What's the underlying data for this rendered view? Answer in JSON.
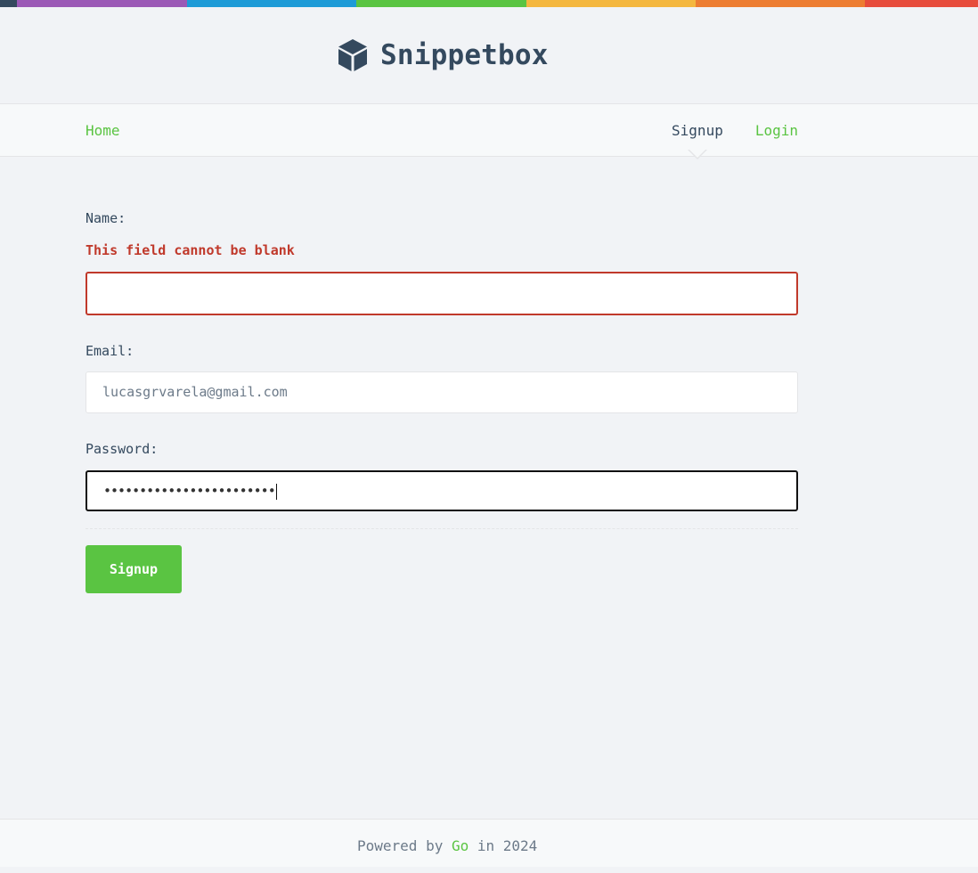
{
  "colors": {
    "bar": [
      "#34495e",
      "#9b59b6",
      "#3498db",
      "#5ac442",
      "#f4b73f",
      "#ed7d32",
      "#e74c3c"
    ],
    "accent": "#5ac442",
    "error": "#c0392b",
    "text": "#34495e"
  },
  "header": {
    "logo_icon": "box-icon",
    "brand": "Snippetbox"
  },
  "nav": {
    "home": "Home",
    "signup": "Signup",
    "login": "Login"
  },
  "form": {
    "name": {
      "label": "Name:",
      "error": "This field cannot be blank",
      "value": ""
    },
    "email": {
      "label": "Email:",
      "value": "lucasgrvarela@gmail.com"
    },
    "password": {
      "label": "Password:",
      "value": "••••••••••••••••••••••••"
    },
    "submit": "Signup"
  },
  "footer": {
    "prefix": "Powered by ",
    "link": "Go",
    "suffix": " in 2024"
  }
}
